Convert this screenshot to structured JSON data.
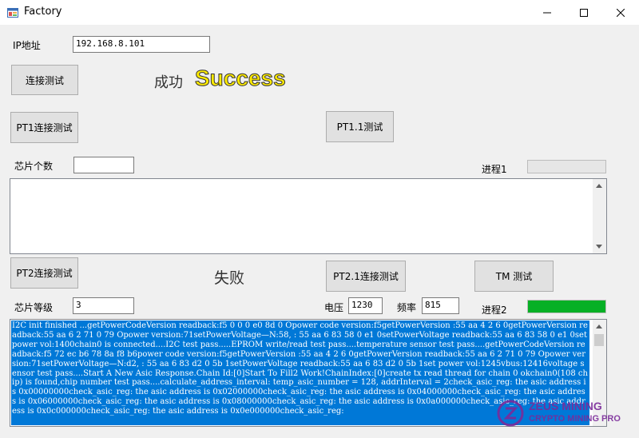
{
  "window": {
    "title": "Factory"
  },
  "form": {
    "ip_label": "IP地址",
    "ip_value": "192.168.8.101",
    "connect_test_button": "连接测试",
    "success_cn": "成功",
    "success_en": "Success",
    "pt1_connect_button": "PT1连接测试",
    "pt11_test_button": "PT1.1测试",
    "chip_count_label": "芯片个数",
    "chip_count_value": "",
    "progress1_label": "进程1",
    "progress1_value": 0,
    "pt2_connect_button": "PT2连接测试",
    "fail_text": "失败",
    "pt21_connect_button": "PT2.1连接测试",
    "tm_test_button": "TM 测试",
    "chip_level_label": "芯片等级",
    "chip_level_value": "3",
    "voltage_label": "电压",
    "voltage_value": "1230",
    "frequency_label": "频率",
    "frequency_value": "815",
    "progress2_label": "进程2",
    "progress2_value": 1.0,
    "progress_fill_color": "#06b025",
    "log_text": "I2C init finished ...getPowerCodeVersion readback:f5 0 0 0 e0 8d 0 Opower code version:f5getPowerVersion :55 aa 4 2 6 0getPowerVersion readback:55 aa 6 2 71 0 79 Opower version:71setPowerVoltage—N:58, : 55 aa 6 83 58 0 e1 0setPowerVoltage readback:55 aa 6 83 58 0 e1 0set power vol:1400chain0 is connected....I2C test pass.....EPROM write/read test pass....temperature sensor test pass....getPowerCodeVersion readback:f5 72 ec b6 78 8a f8 b6power code version:f5getPowerVersion :55 aa 4 2 6 0getPowerVersion readback:55 aa 6 2 71 0 79 Opower version:71setPowerVoltage—N:d2, : 55 aa 6 83 d2 0 5b 1setPowerVoltage readback:55 aa 6 83 d2 0 5b 1set power vol:1245vbus:12416voltage sensor test pass....Start A New Asic Response.Chain Id:[0]Start To Fill2 Work!ChainIndex:[0]create tx read thread for chain 0 okchain0(108 chip) is found,chip number test pass....calculate_address_interval: temp_asic_number = 128, addrInterval = 2check_asic_reg: the asic address is 0x00000000check_asic_reg: the asic address is 0x02000000check_asic_reg: the asic address is 0x04000000check_asic_reg: the asic address is 0x06000000check_asic_reg: the asic address is 0x08000000check_asic_reg: the asic address is 0x0a000000check_asic_reg: the asic address is 0x0c000000check_asic_reg: the asic address is 0x0e000000check_asic_reg:"
  },
  "watermark": {
    "line1": "ZEUS MINING",
    "line2": "CRYPTO MINING PRO"
  }
}
